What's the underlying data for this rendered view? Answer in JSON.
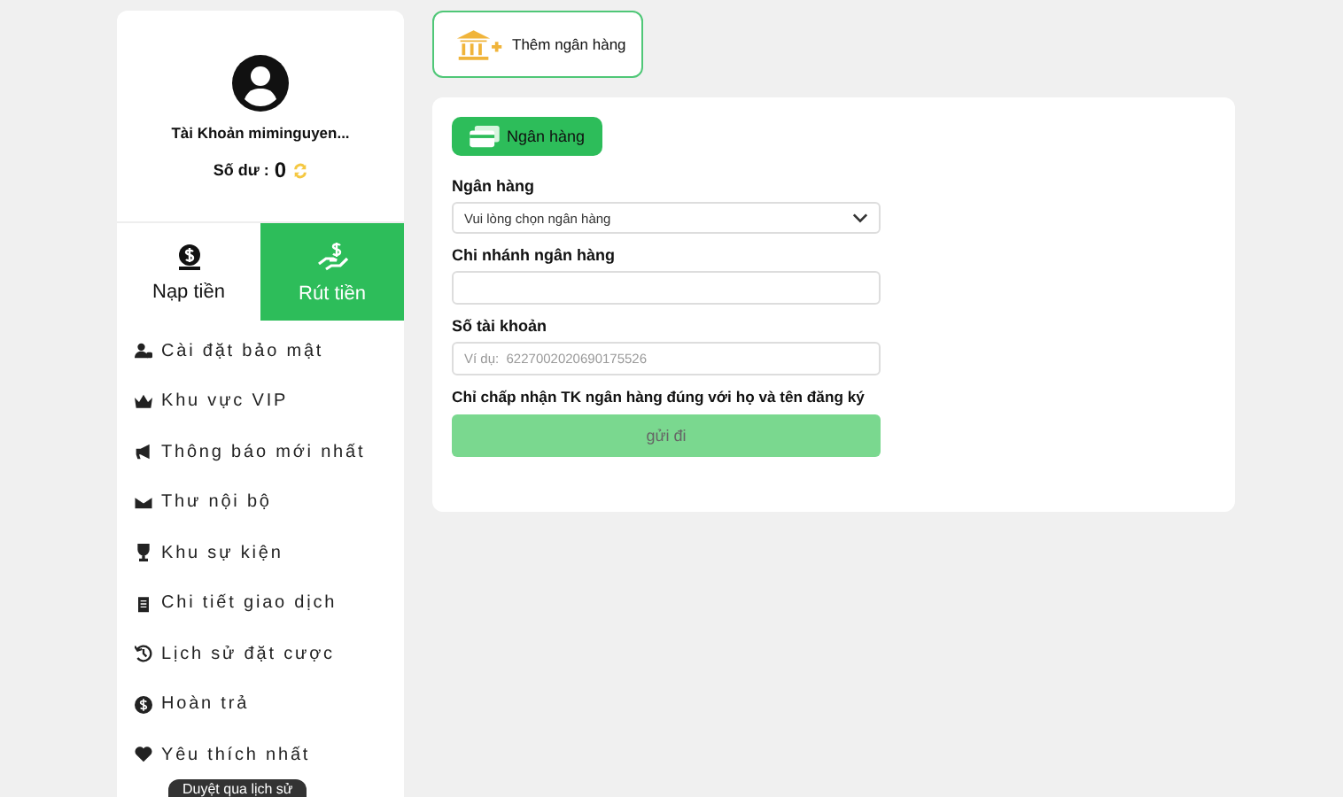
{
  "profile": {
    "account": "Tài Khoản miminguyen...",
    "balance_label": "Số dư :",
    "balance": "0"
  },
  "tabs": [
    {
      "label": "Nạp tiền",
      "selected": false
    },
    {
      "label": "Rút tiền",
      "selected": true
    }
  ],
  "menu": [
    {
      "label": "Cài đặt bảo mật"
    },
    {
      "label": "Khu vực VIP"
    },
    {
      "label": "Thông báo mới nhất"
    },
    {
      "label": "Thư nội bộ"
    },
    {
      "label": "Khu sự kiện"
    },
    {
      "label": "Chi tiết giao dịch"
    },
    {
      "label": "Lịch sử đặt cược"
    },
    {
      "label": "Hoàn trả"
    },
    {
      "label": "Yêu thích nhất"
    }
  ],
  "tooltip": "Duyệt qua lịch sử",
  "add_bank_button": "Thêm ngân hàng",
  "form": {
    "badge": "Ngân hàng",
    "fields": [
      {
        "kind": "select",
        "label": "Ngân hàng",
        "value": "Vui lòng chọn ngân hàng"
      },
      {
        "kind": "input",
        "label": "Chi nhánh ngân hàng"
      },
      {
        "kind": "input",
        "label": "Số tài khoản",
        "placeholder": "Ví dụ:  6227002020690175526"
      }
    ],
    "notice": "Chỉ chấp nhận TK ngân hàng đúng với họ và tên đăng ký",
    "submit": "gửi đi"
  }
}
